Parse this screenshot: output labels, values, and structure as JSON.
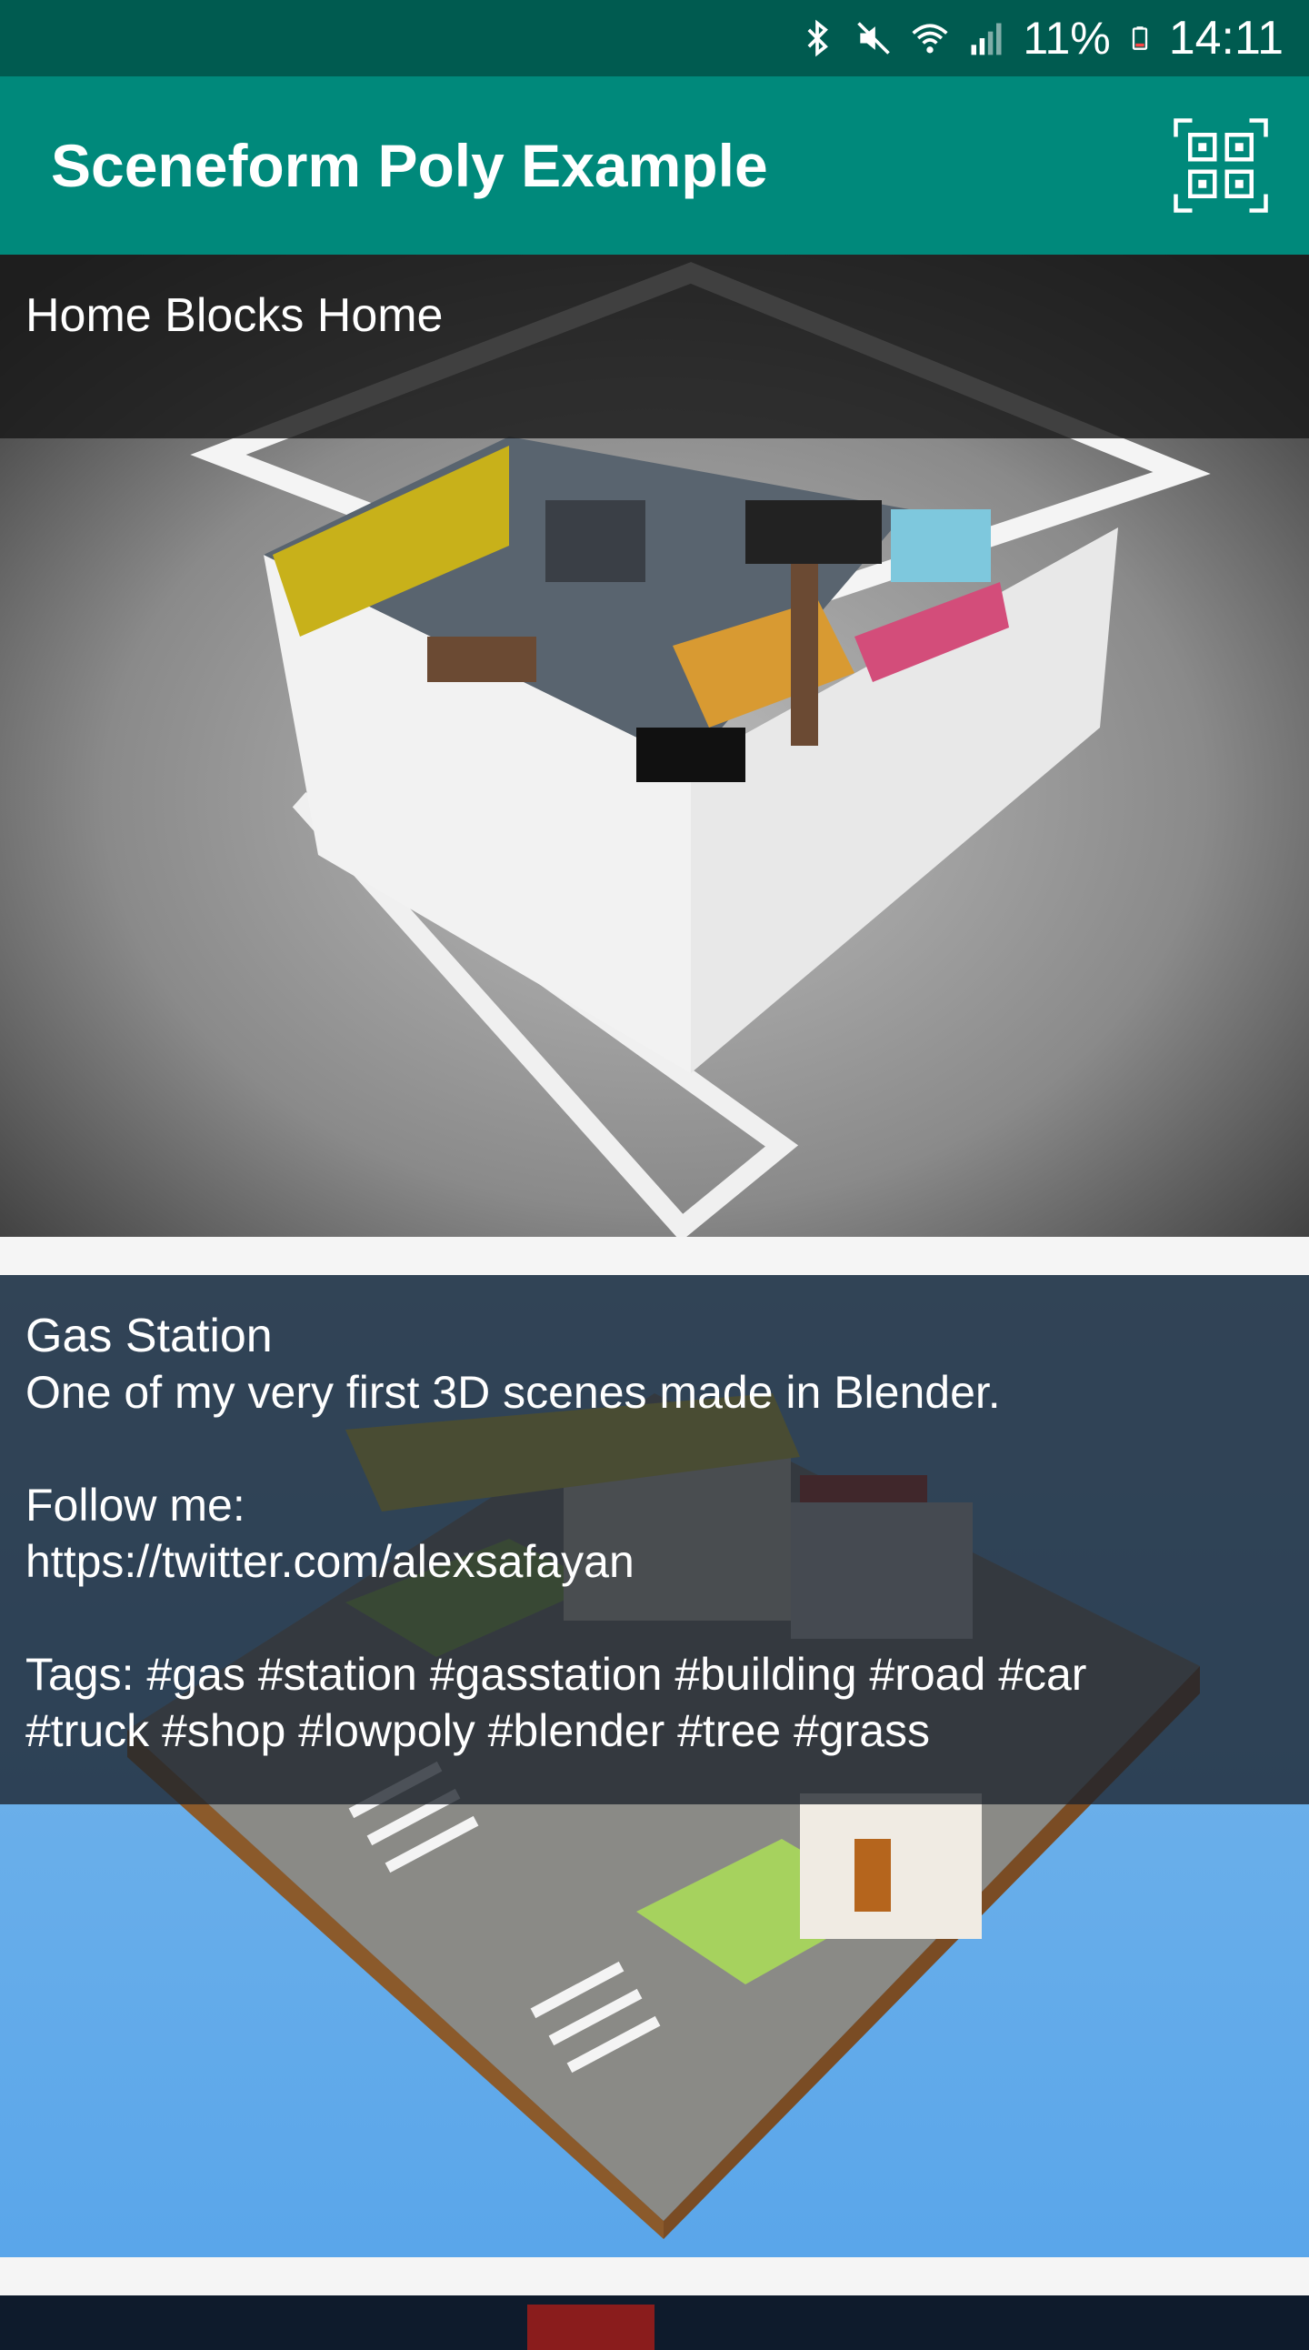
{
  "status_bar": {
    "battery_percent": "11%",
    "time": "14:11",
    "icons": [
      "bluetooth-icon",
      "mute-icon",
      "wifi-icon",
      "signal-icon",
      "battery-icon"
    ]
  },
  "app_bar": {
    "title": "Sceneform Poly Example",
    "action_icon": "qr-code-icon",
    "color": "#00897b"
  },
  "feed": {
    "items": [
      {
        "title": "Home Blocks Home",
        "description": ""
      },
      {
        "title": "Gas Station",
        "description": "One of my very first 3D scenes made in Blender.\n\nFollow me:\nhttps://twitter.com/alexsafayan\n\nTags: #gas #station #gasstation #building #road #car\n#truck #shop #lowpoly #blender #tree #grass"
      }
    ]
  }
}
